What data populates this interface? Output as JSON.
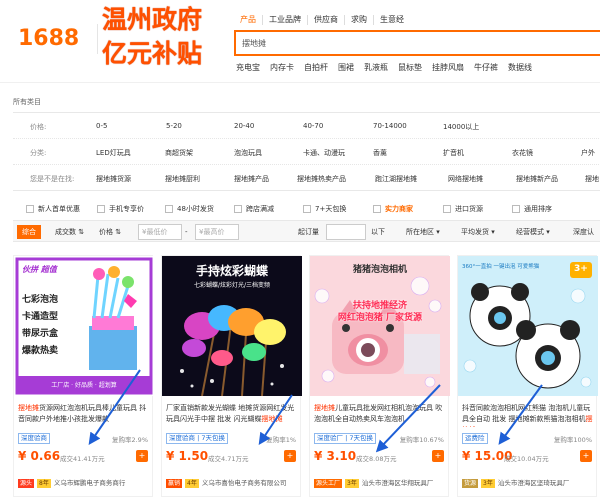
{
  "header": {
    "logo": "1688",
    "promo_line1": "温州政府",
    "promo_line2": "亿元补贴",
    "search_tabs": [
      "产品",
      "工业品牌",
      "供应商",
      "求购",
      "生意经"
    ],
    "search_value": "摆地摊",
    "hot_words": [
      "充电宝",
      "内存卡",
      "自拍杆",
      "围裙",
      "乳液瓶",
      "鼠标垫",
      "挂脖风扇",
      "牛仔裤",
      "数据线"
    ]
  },
  "breadcrumb": "所有类目",
  "filters": {
    "price_label": "价格:",
    "price_ranges": [
      "0-5",
      "5-20",
      "20-40",
      "40-70",
      "70-14000",
      "14000以上"
    ],
    "category_label": "分类:",
    "categories": [
      "LED灯玩具",
      "商超货架",
      "泡泡玩具",
      "卡通、动漫玩",
      "香薰",
      "扩音机",
      "衣花镜",
      "户外"
    ],
    "stall_label": "您是不是在找:",
    "stall_suggestions": [
      "摆地摊货源",
      "摆地摊厨利",
      "摆地摊产品",
      "摆地摊热卖产品",
      "跑江湖摆地摊",
      "网络摆地摊",
      "摆地摊新产品",
      "摆地"
    ]
  },
  "options": [
    "新人首单优惠",
    "手机专享价",
    "48小时发货",
    "跨店满减",
    "7+天包换",
    "实力商家",
    "进口货源",
    "通用排序"
  ],
  "toolbar": {
    "sort_tabs": [
      "综合",
      "成交数",
      "价格"
    ],
    "price_min_placeholder": "¥最低价",
    "price_max_placeholder": "¥最高价",
    "price_dash": "-",
    "moq_label": "起订量",
    "moq_suffix": "以下",
    "location": "所在地区",
    "avg_ship": "平均发货",
    "mode": "经营模式",
    "deep": "深度认"
  },
  "products": [
    {
      "image_caption_1": "伙拼 超值",
      "image_caption_2": "七彩泡泡\n卡通造型\n带尿示盒\n爆款热卖",
      "image_footer": "工厂店 · 好品质 · 超划算",
      "title_hl": "摆地摊",
      "title_rest": "货源网红泡泡机玩具棒儿童玩具 抖音同款户外地推小孩批发爆款",
      "badge": "深度验商",
      "repeat": "复购率2.9%",
      "price": "¥ 0.66",
      "sold": "成交41.41万元",
      "shop_tag": "源头",
      "shop_tag2": "8年",
      "shop_name": "义乌市辉鹏电子商务商行"
    },
    {
      "image_caption_1": "手持炫彩蝴蝶",
      "image_caption_2": "七彩蝴蝶/炫彩灯光/三档变频",
      "title_hl": "摆地摊",
      "title_rest": "厂家直销新款发光蝴蝶 地摊货源网红发光玩具闪光手中摆 批发 闪光蝴蝶",
      "badge": "深度验商 | 7天包换",
      "repeat": "复购率1%",
      "price": "¥ 1.50",
      "sold": "成交4.71万元",
      "shop_tag": "赢销",
      "shop_tag2": "4年",
      "shop_name": "义乌市喜怡电子商务有限公司"
    },
    {
      "image_caption_1": "猪猪泡泡相机",
      "image_caption_2": "扶持地推经济\n网红泡泡猪 厂家货源",
      "title_hl": "摆地摊",
      "title_rest": "儿童玩具批发网红相机泡泡玩具 吹泡泡机全自动热卖风车泡泡机",
      "badge": "深度验厂 | 7天包换",
      "repeat": "复购率10.67%",
      "price": "¥ 3.10",
      "sold": "成交8.08万元",
      "shop_tag": "源头工厂",
      "shop_tag2": "3年",
      "shop_name": "汕头市澄海区华翔玩具厂"
    },
    {
      "image_caption_1": "360°一直拍 一键出泡 可爱熊猫",
      "image_caption_2": "3+",
      "title_hl": "摆地摊",
      "title_rest": "抖音同款泡泡相机网红熊猫 泡泡机儿童玩具全自动 批发 摆地摊新款熊猫泡泡相机",
      "badge": "运费险",
      "repeat": "复购率100%",
      "price": "¥ 15.00",
      "sold": "成交10.04万元",
      "shop_tag": "货源",
      "shop_tag2": "3年",
      "shop_name": "汕头市澄海区坚琦玩具厂"
    }
  ]
}
